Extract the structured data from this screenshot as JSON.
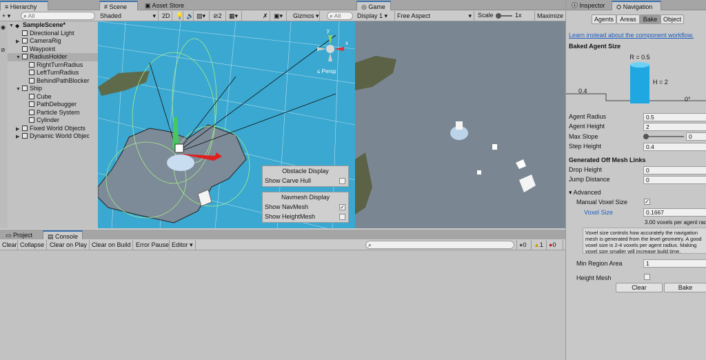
{
  "hierarchy": {
    "tab": "Hierarchy",
    "add_label": "+ ▾",
    "search_placeholder": "All",
    "items": [
      {
        "label": "SampleScene*",
        "depth": 0,
        "arrow": "▼",
        "bold": true
      },
      {
        "label": "Directional Light",
        "depth": 1,
        "arrow": ""
      },
      {
        "label": "CameraRig",
        "depth": 1,
        "arrow": "▶"
      },
      {
        "label": "Waypoint",
        "depth": 1,
        "arrow": ""
      },
      {
        "label": "RadiusHolder",
        "depth": 1,
        "arrow": "▼",
        "selected": true
      },
      {
        "label": "RightTurnRadius",
        "depth": 2,
        "arrow": ""
      },
      {
        "label": "LeftTurnRadius",
        "depth": 2,
        "arrow": ""
      },
      {
        "label": "BehindPathBlocker",
        "depth": 2,
        "arrow": ""
      },
      {
        "label": "Ship",
        "depth": 1,
        "arrow": "▼"
      },
      {
        "label": "Cube",
        "depth": 2,
        "arrow": ""
      },
      {
        "label": "PathDebugger",
        "depth": 2,
        "arrow": ""
      },
      {
        "label": "Particle System",
        "depth": 2,
        "arrow": ""
      },
      {
        "label": "Cylinder",
        "depth": 2,
        "arrow": ""
      },
      {
        "label": "Fixed World Objects",
        "depth": 1,
        "arrow": "▶"
      },
      {
        "label": "Dynamic World Objec",
        "depth": 1,
        "arrow": "▶"
      }
    ]
  },
  "scene": {
    "tab_scene": "Scene",
    "tab_asset": "Asset Store",
    "shading": "Shaded",
    "mode_2d": "2D",
    "hidden_count": "2",
    "gizmos": "Gizmos",
    "search_placeholder": "All",
    "persp": "≤ Persp",
    "axis_y": "y",
    "axis_x": "x",
    "obstacle_title": "Obstacle Display",
    "show_carve_hull": "Show Carve Hull",
    "navmesh_title": "Navmesh Display",
    "show_navmesh": "Show NavMesh",
    "show_heightmesh": "Show HeightMesh",
    "check_mark": "✓"
  },
  "game": {
    "tab": "Game",
    "display": "Display 1",
    "aspect": "Free Aspect",
    "scale_label": "Scale",
    "scale_value": "1x",
    "maximize": "Maximize"
  },
  "console": {
    "tab_project": "Project",
    "tab_console": "Console",
    "clear": "Clear",
    "collapse": "Collapse",
    "clear_on_play": "Clear on Play",
    "clear_on_build": "Clear on Build",
    "error_pause": "Error Pause",
    "editor": "Editor",
    "count_info": "0",
    "count_warn": "1",
    "count_error": "0"
  },
  "inspector": {
    "tab_inspector": "Inspector",
    "tab_navigation": "Navigation",
    "subtabs": [
      "Agents",
      "Areas",
      "Bake",
      "Object"
    ],
    "link": "Learn instead about the component workflow.",
    "baked_size_title": "Baked Agent Size",
    "r_label": "R = 0.5",
    "h_label": "H = 2",
    "step_left": "0.4",
    "angle": "0°",
    "agent_radius_label": "Agent Radius",
    "agent_radius": "0.5",
    "agent_height_label": "Agent Height",
    "agent_height": "2",
    "max_slope_label": "Max Slope",
    "max_slope": "0",
    "step_height_label": "Step Height",
    "step_height": "0.4",
    "offmesh_title": "Generated Off Mesh Links",
    "drop_height_label": "Drop Height",
    "drop_height": "0",
    "jump_distance_label": "Jump Distance",
    "jump_distance": "0",
    "advanced_label": "Advanced",
    "manual_voxel_label": "Manual Voxel Size",
    "voxel_size_label": "Voxel Size",
    "voxel_size": "0.1667",
    "voxels_per_radius": "3.00 voxels per agent radi",
    "help_text": "Voxel size controls how accurately the navigation mesh is generated from the level geometry. A good voxel size is 2-4 voxels per agent radius. Making voxel size smaller will increase build time.",
    "min_region_label": "Min Region Area",
    "min_region": "1",
    "height_mesh_label": "Height Mesh",
    "clear_btn": "Clear",
    "bake_btn": "Bake",
    "check_mark": "✓"
  },
  "colors": {
    "accent": "#3a72b0",
    "sky": "#3aa8d0",
    "game_bg": "#7a8792",
    "selected": "#9fb6d6"
  }
}
